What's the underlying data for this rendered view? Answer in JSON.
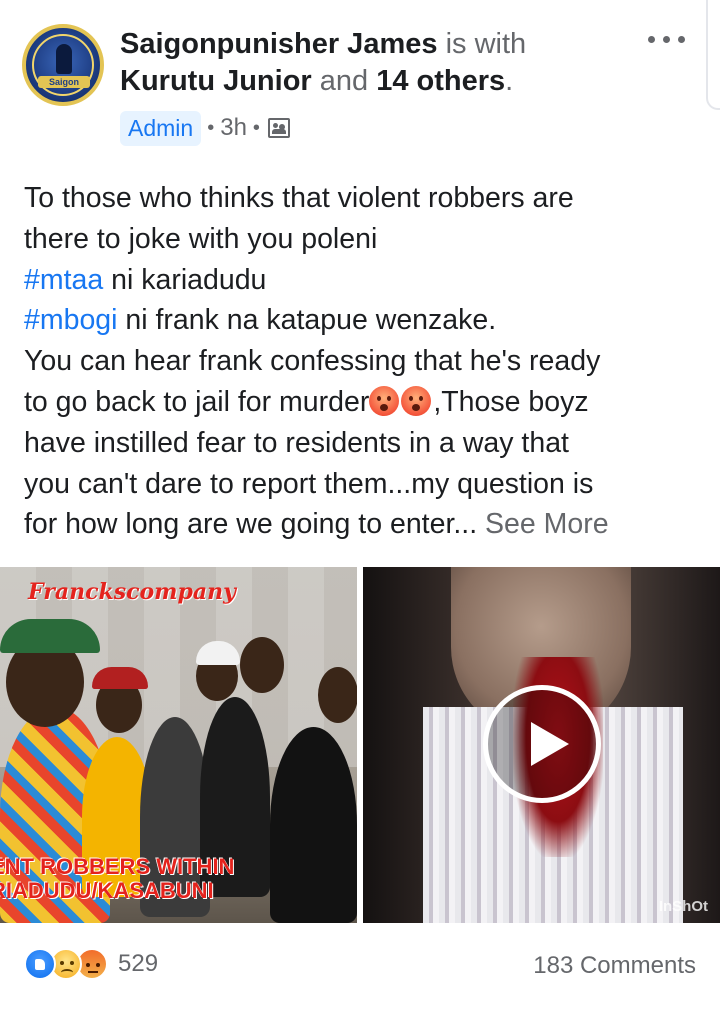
{
  "post": {
    "author": "Saigonpunisher James",
    "with_text": "is with",
    "tagged_person": "Kurutu Junior",
    "and_text": "and",
    "others": "14 others",
    "period": ".",
    "avatar_text": "Saigon",
    "badge": "Admin",
    "separator": "•",
    "time": "3h",
    "audience_icon": "group-photo-icon",
    "more_icon": "more-options-icon"
  },
  "body": {
    "line1": "To those who thinks that violent robbers are",
    "line2": "there to joke with you poleni",
    "hashtag1": "#mtaa",
    "line3_rest": " ni kariadudu",
    "hashtag2": "#mbogi",
    "line4_rest": " ni frank na katapue wenzake.",
    "line5": "You can hear frank confessing that he's ready",
    "line6_start": "to go back to jail for murder",
    "line6_end": ",Those boyz",
    "line7": "have instilled fear to residents in a way that",
    "line8": "you can't dare to report them...my question is",
    "line9": "for how long are we going to enter... ",
    "see_more": "See More"
  },
  "media": {
    "left_title": "Franckscompany",
    "left_caption_1": "ENT ROBBERS WITHIN",
    "left_caption_2": "RIADUDU/KASABUNI",
    "right_watermark": "InShOt"
  },
  "footer": {
    "reaction_count": "529",
    "comments": "183 Comments",
    "reactions": [
      "like",
      "sad",
      "angry"
    ]
  },
  "colors": {
    "link": "#1877f2",
    "muted": "#65676b",
    "text": "#1c1e21",
    "badge_bg": "#e7f3ff"
  }
}
